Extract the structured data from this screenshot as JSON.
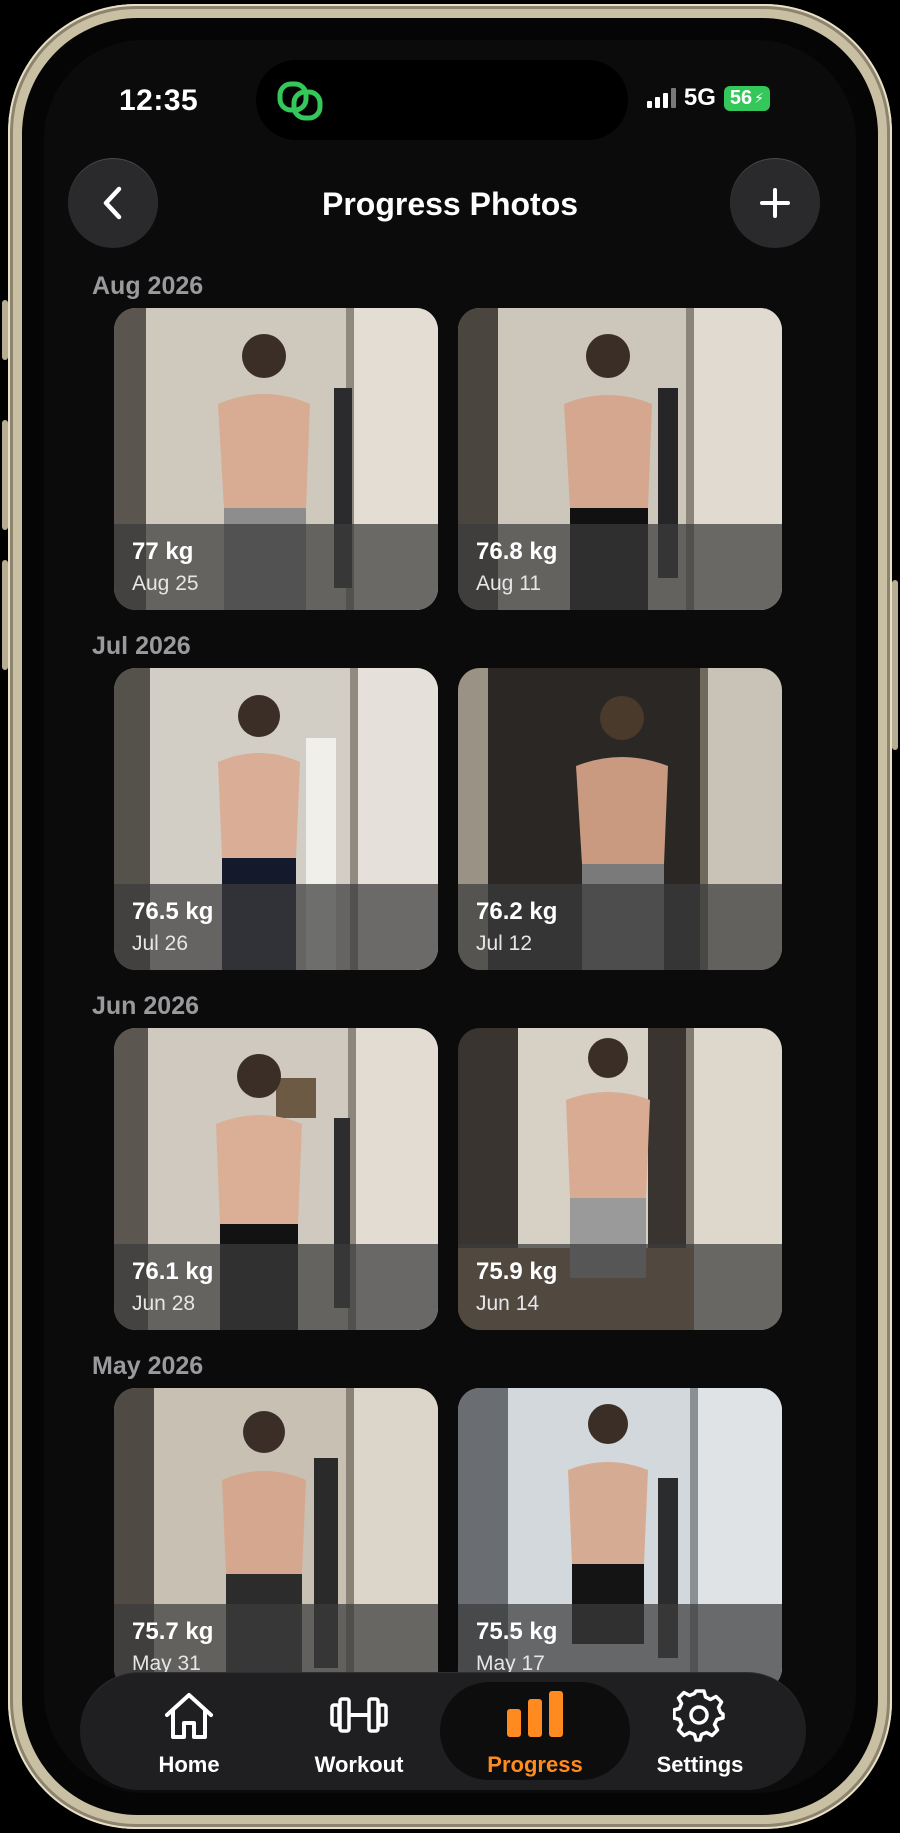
{
  "status": {
    "time": "12:35",
    "network": "5G",
    "battery": "56"
  },
  "header": {
    "title": "Progress Photos"
  },
  "groups": [
    {
      "month": "Aug 2026",
      "photos": [
        {
          "weight": "77 kg",
          "date": "Aug 25"
        },
        {
          "weight": "76.8 kg",
          "date": "Aug 11"
        }
      ]
    },
    {
      "month": "Jul 2026",
      "photos": [
        {
          "weight": "76.5 kg",
          "date": "Jul 26"
        },
        {
          "weight": "76.2 kg",
          "date": "Jul 12"
        }
      ]
    },
    {
      "month": "Jun 2026",
      "photos": [
        {
          "weight": "76.1 kg",
          "date": "Jun 28"
        },
        {
          "weight": "75.9 kg",
          "date": "Jun 14"
        }
      ]
    },
    {
      "month": "May 2026",
      "photos": [
        {
          "weight": "75.7 kg",
          "date": "May 31"
        },
        {
          "weight": "75.5 kg",
          "date": "May 17"
        }
      ]
    }
  ],
  "tabbar": {
    "items": [
      {
        "label": "Home",
        "icon": "home-icon"
      },
      {
        "label": "Workout",
        "icon": "dumbbell-icon"
      },
      {
        "label": "Progress",
        "icon": "bar-chart-icon"
      },
      {
        "label": "Settings",
        "icon": "gear-icon"
      }
    ],
    "active": "Progress"
  },
  "colors": {
    "accent": "#ff8a1f",
    "background": "#0b0b0b",
    "island_logo": "#34c759"
  }
}
